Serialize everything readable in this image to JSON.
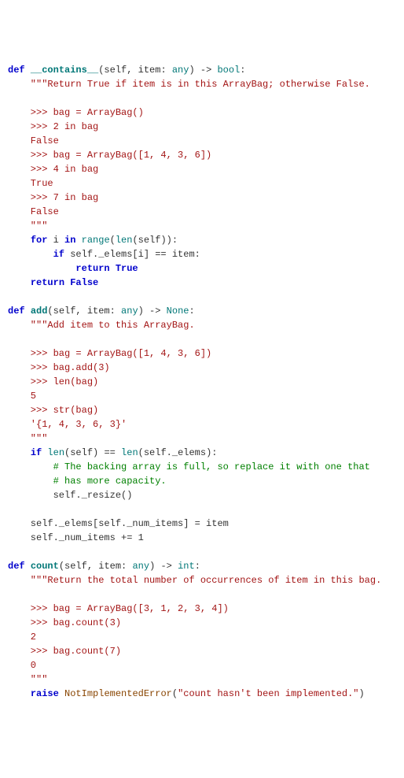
{
  "contains": {
    "def": "def",
    "name": "__contains__",
    "params_open": "(self, item: ",
    "type_any": "any",
    "params_close": ") -> ",
    "ret_bool": "bool",
    "colon": ":",
    "doc1": "    \"\"\"Return True if item is in this ArrayBag; otherwise False.",
    "d_blank1": "",
    "d_ex1": "    >>> bag = ArrayBag()",
    "d_ex2": "    >>> 2 in bag",
    "d_ex3": "    False",
    "d_ex4": "    >>> bag = ArrayBag([1, 4, 3, 6])",
    "d_ex5": "    >>> 4 in bag",
    "d_ex6": "    True",
    "d_ex7": "    >>> 7 in bag",
    "d_ex8": "    False",
    "doc_end": "    \"\"\"",
    "for": "for",
    "i": " i ",
    "in": "in",
    "range": " range",
    "len": "len",
    "for_tail": "(self)):",
    "if": "if",
    "if_body": " self._elems[i] == item:",
    "ret_t": "return True",
    "ret_f": "return False"
  },
  "add": {
    "def": "def",
    "name": "add",
    "params_open": "(self, item: ",
    "type_any": "any",
    "params_close": ") -> ",
    "ret_none": "None",
    "colon": ":",
    "doc1": "    \"\"\"Add item to this ArrayBag.",
    "d_blank1": "",
    "d_ex1": "    >>> bag = ArrayBag([1, 4, 3, 6])",
    "d_ex2": "    >>> bag.add(3)",
    "d_ex3": "    >>> len(bag)",
    "d_ex4": "    5",
    "d_ex5": "    >>> str(bag)",
    "d_ex6": "    '{1, 4, 3, 6, 3}'",
    "doc_end": "    \"\"\"",
    "if": "if",
    "len1": " len",
    "if_mid": "(self) == ",
    "len2": "len",
    "if_tail": "(self._elems):",
    "cmt1": "        # The backing array is full, so replace it with one that",
    "cmt2": "        # has more capacity.",
    "resize": "        self._resize()",
    "assign1": "    self._elems[self._num_items] = item",
    "assign2": "    self._num_items += 1"
  },
  "count": {
    "def": "def",
    "name": "count",
    "params_open": "(self, item: ",
    "type_any": "any",
    "params_close": ") -> ",
    "ret_int": "int",
    "colon": ":",
    "doc1": "    \"\"\"Return the total number of occurrences of item in this bag.",
    "d_blank1": "",
    "d_ex1": "    >>> bag = ArrayBag([3, 1, 2, 3, 4])",
    "d_ex2": "    >>> bag.count(3)",
    "d_ex3": "    2",
    "d_ex4": "    >>> bag.count(7)",
    "d_ex5": "    0",
    "doc_end": "    \"\"\"",
    "raise": "raise",
    "err": " NotImplementedError",
    "msg": "\"count hasn't been implemented.\"",
    "open": "(",
    "close": ")"
  }
}
